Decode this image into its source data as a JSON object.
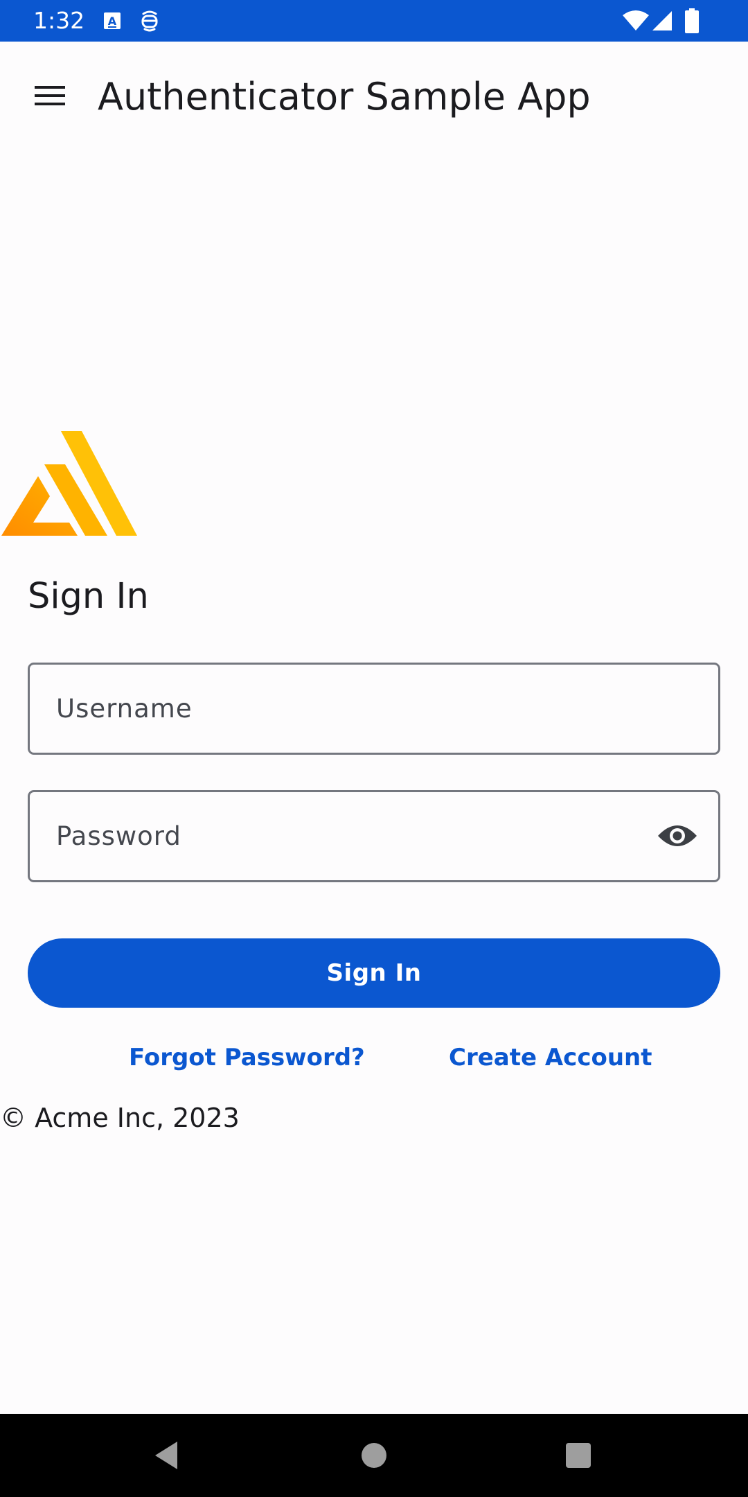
{
  "status_bar": {
    "time": "1:32",
    "background": "#0b57d0",
    "left_icons": [
      "text-recognition-icon",
      "face-id-icon"
    ],
    "right_icons": [
      "wifi-icon",
      "cellular-signal-icon",
      "battery-icon"
    ]
  },
  "app_bar": {
    "menu_icon": "hamburger-menu-icon",
    "title": "Authenticator Sample App"
  },
  "logo": {
    "icon": "amplify-logo-icon",
    "colors": [
      "#ff9900",
      "#ffb300",
      "#ffc107"
    ]
  },
  "form": {
    "heading": "Sign In",
    "username": {
      "value": "",
      "placeholder": "Username"
    },
    "password": {
      "value": "",
      "placeholder": "Password",
      "toggle_icon": "eye-icon"
    },
    "submit_label": "Sign In",
    "forgot_password_label": "Forgot Password?",
    "create_account_label": "Create Account"
  },
  "footer": {
    "copyright": "© Acme Inc, 2023"
  },
  "nav_bar": {
    "icons": [
      "back-icon",
      "home-icon",
      "recents-icon"
    ]
  },
  "colors": {
    "primary": "#0b57d0",
    "background": "#fdfcfd",
    "outline": "#74777f",
    "on_surface": "#1b1b1f"
  }
}
